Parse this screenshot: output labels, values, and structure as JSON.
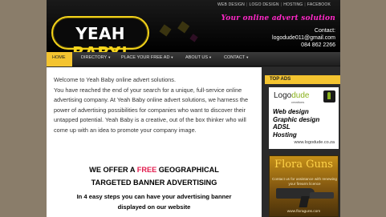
{
  "top_links": [
    "WEB DESIGN",
    "LOGO DESIGN",
    "HOSTING",
    "FACEBOOK"
  ],
  "logo": {
    "part1": "YEAH ",
    "part2": "BABY!"
  },
  "tagline": "Your online advert solution",
  "contact": {
    "label": "Contact:",
    "email": "logodude011@gmail.com",
    "phone": "084 862 2266"
  },
  "nav": [
    {
      "label": "HOME"
    },
    {
      "label": "DIRECTORY"
    },
    {
      "label": "PLACE YOUR FREE AD"
    },
    {
      "label": "ABOUT US"
    },
    {
      "label": "CONTACT"
    }
  ],
  "content": {
    "intro": "Welcome to Yeah Baby online advert solutions.\nYou have reached the end of your search for a unique, full-service online advertising company. At Yeah Baby online advert solutions, we harness the power of advertising possibilities for companies who want to discover their untapped potential. Yeah Baby is a creative, out of the box thinker who will come up with an idea to promote your company image.",
    "offer_line1_pre": "WE OFFER A ",
    "offer_free": "FREE",
    "offer_line1_post": " GEOGRAPHICAL",
    "offer_line2": "TARGETED BANNER ADVERTISING",
    "steps_line1": "In 4 easy steps you can have your advertising banner",
    "steps_line2": "displayed on our website"
  },
  "sidebar": {
    "heading": "TOP ADS",
    "ad1": {
      "brand1": "Logo",
      "brand2": "dude",
      "sub": "creations",
      "lines": [
        "Web design",
        "Graphic design",
        "ADSL",
        "Hosting"
      ],
      "url": "www.logodude.co.za"
    },
    "ad2": {
      "title": "Flora Guns",
      "text": "Contact us for assistance with renewing your firearm licence",
      "url": "www.floraguns.com"
    }
  }
}
